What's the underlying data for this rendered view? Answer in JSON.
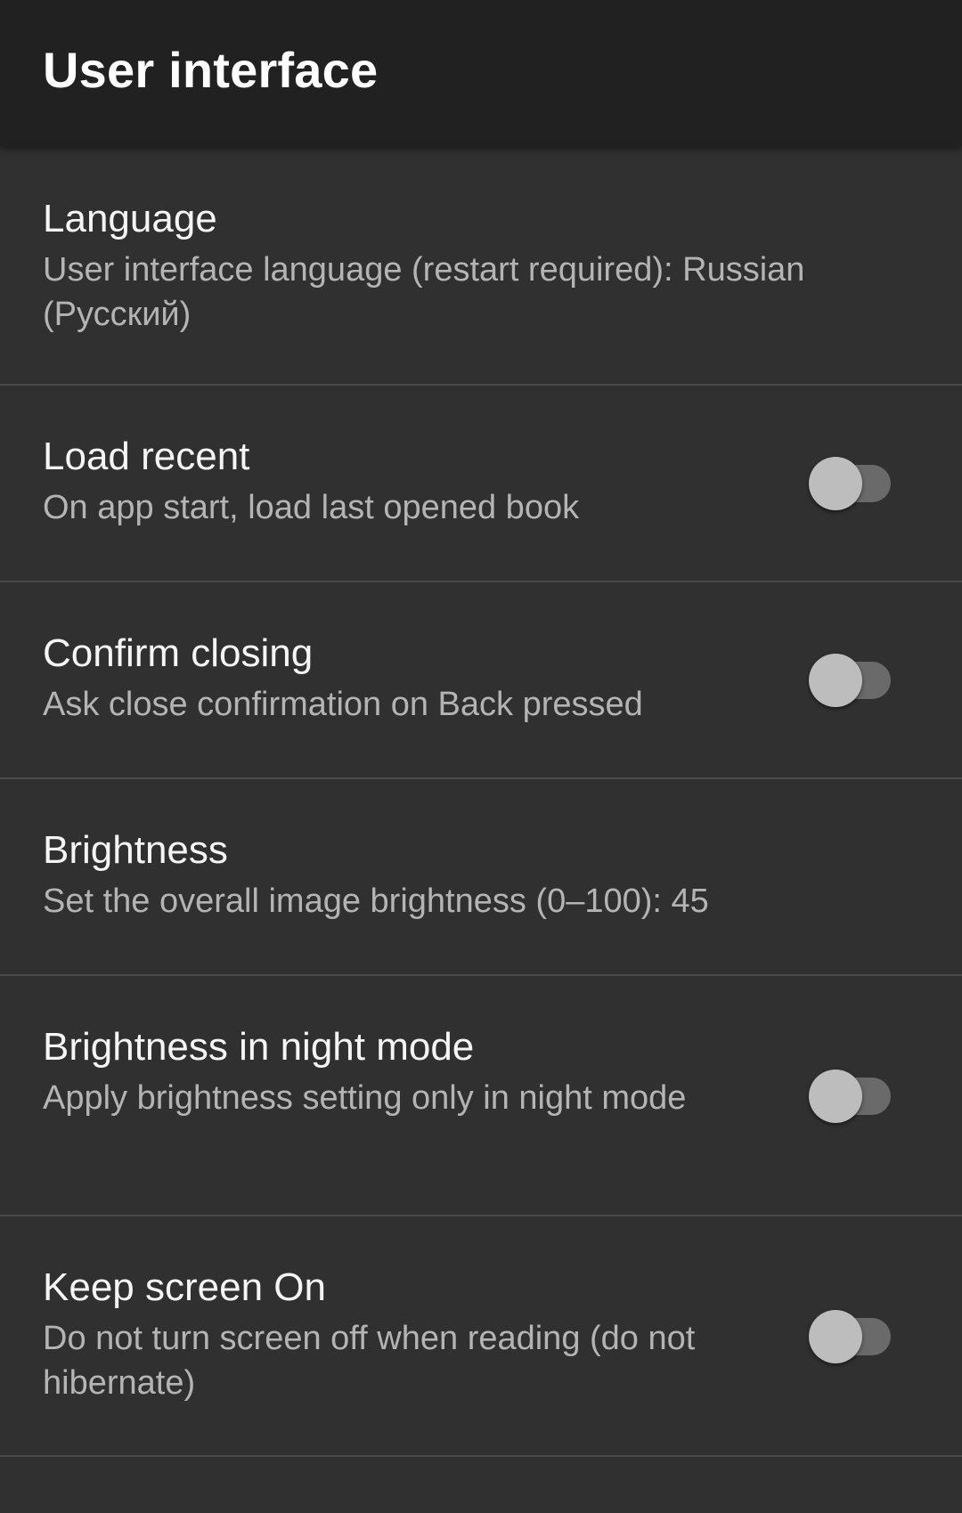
{
  "toolbar": {
    "title": "User interface"
  },
  "preferences": [
    {
      "title": "Language",
      "summary": "User interface language (restart required): Russian (Русский)",
      "has_switch": false
    },
    {
      "title": "Load recent",
      "summary": "On app start, load last opened book",
      "has_switch": true,
      "checked": false
    },
    {
      "title": "Confirm closing",
      "summary": "Ask close confirmation on Back pressed",
      "has_switch": true,
      "checked": false
    },
    {
      "title": "Brightness",
      "summary": "Set the overall image brightness (0–100): 45",
      "has_switch": false
    },
    {
      "title": "Brightness in night mode",
      "summary": "Apply brightness setting only in night mode",
      "has_switch": true,
      "checked": false
    },
    {
      "title": "Keep screen On",
      "summary": "Do not turn screen off when reading (do not hibernate)",
      "has_switch": true,
      "checked": false
    }
  ],
  "colors": {
    "background": "#303030",
    "toolbar": "#212121",
    "title_text": "#f5f5f5",
    "summary_text": "#b4b4b4",
    "switch_thumb_off": "#bdbdbd",
    "switch_track_off": "#6a6a6a"
  }
}
